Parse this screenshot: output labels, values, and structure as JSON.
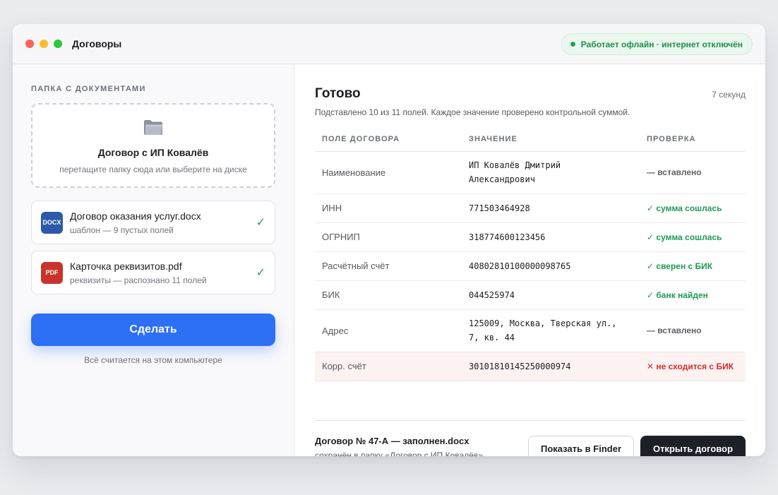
{
  "window": {
    "title": "Договоры",
    "status": "Работает офлайн · интернет отключён",
    "status_color": "#1f8f4a"
  },
  "left": {
    "section_label": "ПАПКА С ДОКУМЕНТАМИ",
    "dropzone": {
      "icon": "folder-icon",
      "title": "Договор с ИП Ковалёв",
      "hint": "перетащите папку сюда или выберите на диске"
    },
    "files": [
      {
        "badge": "DOCX",
        "badge_color": "#2b5aa8",
        "name": "Договор оказания услуг.docx",
        "meta": "шаблон — 9 пустых полей",
        "status_icon": "check-icon"
      },
      {
        "badge": "PDF",
        "badge_color": "#c8342c",
        "name": "Карточка реквизитов.pdf",
        "meta": "реквизиты — распознано 11 полей",
        "status_icon": "check-icon"
      }
    ],
    "action_label": "Сделать",
    "action_color": "#2d6ff5",
    "local_note": "Всё считается на этом компьютере"
  },
  "result": {
    "title": "Готово",
    "duration": "7 секунд",
    "summary": "Подставлено 10 из 11 полей. Каждое значение проверено контрольной суммой.",
    "columns": [
      "ПОЛЕ ДОГОВОРА",
      "ЗНАЧЕНИЕ",
      "ПРОВЕРКА"
    ],
    "rows": [
      {
        "field": "Наименование",
        "value": "ИП Ковалёв Дмитрий\nАлександрович",
        "check": "— вставлено",
        "state": "neutral"
      },
      {
        "field": "ИНН",
        "value": "771503464928",
        "check": "✓ сумма сошлась",
        "state": "ok"
      },
      {
        "field": "ОГРНИП",
        "value": "318774600123456",
        "check": "✓ сумма сошлась",
        "state": "ok"
      },
      {
        "field": "Расчётный счёт",
        "value": "40802810100000098765",
        "check": "✓ сверен с БИК",
        "state": "ok"
      },
      {
        "field": "БИК",
        "value": "044525974",
        "check": "✓ банк найден",
        "state": "ok"
      },
      {
        "field": "Адрес",
        "value": "125009, Москва, Тверская ул.,\n7, кв. 44",
        "check": "— вставлено",
        "state": "neutral"
      },
      {
        "field": "Корр. счёт",
        "value": "30101810145250000974",
        "check": "✕ не сходится с БИК",
        "state": "bad"
      }
    ],
    "output": {
      "file_name": "Договор № 47-А — заполнен.docx",
      "saved_to": "сохранён в папку «Договор с ИП Ковалёв»"
    },
    "show_in_finder_label": "Показать в Finder",
    "open_label": "Открыть договор"
  }
}
